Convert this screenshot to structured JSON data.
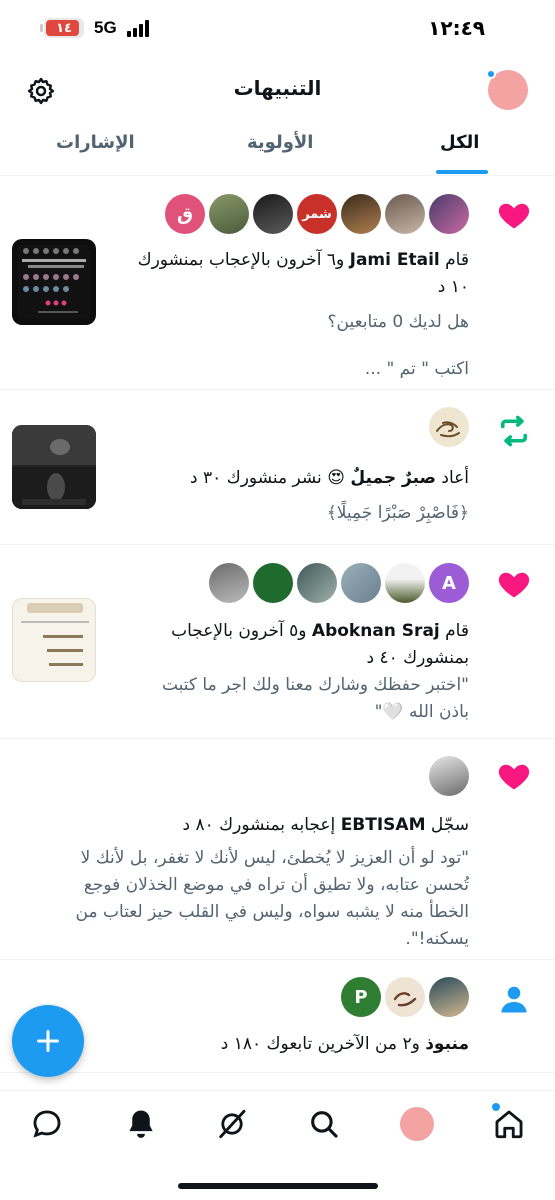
{
  "status_bar": {
    "time": "١٢:٤٩",
    "network": "5G",
    "battery": "١٤"
  },
  "header": {
    "title": "التنبيهات",
    "icons": {
      "settings": "gear-icon",
      "avatar": "profile-avatar"
    }
  },
  "tabs": [
    {
      "label": "الكل",
      "active": true
    },
    {
      "label": "الأولوية",
      "active": false
    },
    {
      "label": "الإشارات",
      "active": false
    }
  ],
  "notifications": [
    {
      "type": "like",
      "avatar_letter": "ق",
      "actor": "Jami Etail",
      "text_before": "قام",
      "text_after": "و٦ آخرون بالإعجاب بمنشورك",
      "time": "١٠ د",
      "post_line1": "هل لديك 0 متابعين؟",
      "post_line2": "اكتب \" تم \" ...",
      "avatar_badge_text": "شمر"
    },
    {
      "type": "repost",
      "text_before": "أعاد",
      "actor": "صبرٌ جميلٌ",
      "text_after": "نشر منشورك",
      "time": "٣٠ د",
      "post_line1": "﴿فَاصْبِرْ صَبْرًا جَمِيلًا﴾"
    },
    {
      "type": "like",
      "avatar_letter": "A",
      "text_before": "قام",
      "actor": "Aboknan Sraj",
      "text_after": "و٥ آخرون بالإعجاب",
      "line2": "بمنشورك",
      "time": "٤٠ د",
      "post_line1": "\"اختبر حفظك وشارك معنا ولك اجر ما كتبت",
      "post_line2": "باذن الله 🤍\""
    },
    {
      "type": "like",
      "text_before": "سجّل",
      "actor": "EBTISAM",
      "text_after": "إعجابه بمنشورك",
      "time": "٨٠ د",
      "post_line1": "\"تود لو أن العزيز لا يُخطئ، ليس لأنك لا تغفر، بل لأنك لا",
      "post_line2": "تُحسن عتابه، ولا تطيق أن تراه في موضع الخذلان فوجع",
      "post_line3": "الخطأ منه لا يشبه سواه، وليس في القلب حيز لعتاب من",
      "post_line4": "يسكنه!\"."
    },
    {
      "type": "follow",
      "avatar_letter": "P",
      "actor": "منبوذ",
      "text_after": "و٢ من الآخرين تابعوك",
      "time": "١٨٠ د"
    }
  ],
  "colors": {
    "accent": "#1d9bf0",
    "like": "#f91880",
    "repost": "#00ba7c",
    "text": "#0f1419",
    "secondary": "#536471"
  }
}
